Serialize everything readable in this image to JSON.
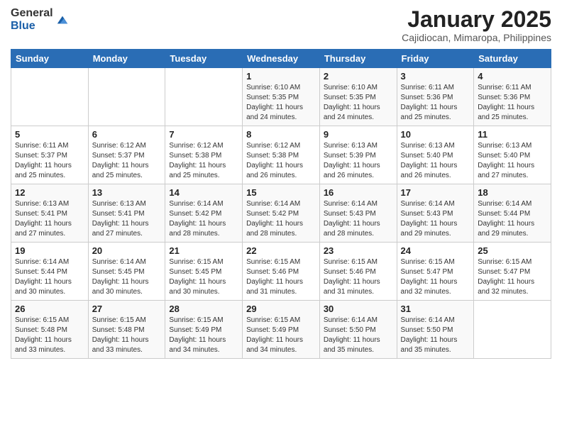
{
  "logo": {
    "general": "General",
    "blue": "Blue"
  },
  "header": {
    "title": "January 2025",
    "location": "Cajidiocan, Mimaropa, Philippines"
  },
  "weekdays": [
    "Sunday",
    "Monday",
    "Tuesday",
    "Wednesday",
    "Thursday",
    "Friday",
    "Saturday"
  ],
  "weeks": [
    [
      {
        "day": "",
        "info": ""
      },
      {
        "day": "",
        "info": ""
      },
      {
        "day": "",
        "info": ""
      },
      {
        "day": "1",
        "info": "Sunrise: 6:10 AM\nSunset: 5:35 PM\nDaylight: 11 hours and 24 minutes."
      },
      {
        "day": "2",
        "info": "Sunrise: 6:10 AM\nSunset: 5:35 PM\nDaylight: 11 hours and 24 minutes."
      },
      {
        "day": "3",
        "info": "Sunrise: 6:11 AM\nSunset: 5:36 PM\nDaylight: 11 hours and 25 minutes."
      },
      {
        "day": "4",
        "info": "Sunrise: 6:11 AM\nSunset: 5:36 PM\nDaylight: 11 hours and 25 minutes."
      }
    ],
    [
      {
        "day": "5",
        "info": "Sunrise: 6:11 AM\nSunset: 5:37 PM\nDaylight: 11 hours and 25 minutes."
      },
      {
        "day": "6",
        "info": "Sunrise: 6:12 AM\nSunset: 5:37 PM\nDaylight: 11 hours and 25 minutes."
      },
      {
        "day": "7",
        "info": "Sunrise: 6:12 AM\nSunset: 5:38 PM\nDaylight: 11 hours and 25 minutes."
      },
      {
        "day": "8",
        "info": "Sunrise: 6:12 AM\nSunset: 5:38 PM\nDaylight: 11 hours and 26 minutes."
      },
      {
        "day": "9",
        "info": "Sunrise: 6:13 AM\nSunset: 5:39 PM\nDaylight: 11 hours and 26 minutes."
      },
      {
        "day": "10",
        "info": "Sunrise: 6:13 AM\nSunset: 5:40 PM\nDaylight: 11 hours and 26 minutes."
      },
      {
        "day": "11",
        "info": "Sunrise: 6:13 AM\nSunset: 5:40 PM\nDaylight: 11 hours and 27 minutes."
      }
    ],
    [
      {
        "day": "12",
        "info": "Sunrise: 6:13 AM\nSunset: 5:41 PM\nDaylight: 11 hours and 27 minutes."
      },
      {
        "day": "13",
        "info": "Sunrise: 6:13 AM\nSunset: 5:41 PM\nDaylight: 11 hours and 27 minutes."
      },
      {
        "day": "14",
        "info": "Sunrise: 6:14 AM\nSunset: 5:42 PM\nDaylight: 11 hours and 28 minutes."
      },
      {
        "day": "15",
        "info": "Sunrise: 6:14 AM\nSunset: 5:42 PM\nDaylight: 11 hours and 28 minutes."
      },
      {
        "day": "16",
        "info": "Sunrise: 6:14 AM\nSunset: 5:43 PM\nDaylight: 11 hours and 28 minutes."
      },
      {
        "day": "17",
        "info": "Sunrise: 6:14 AM\nSunset: 5:43 PM\nDaylight: 11 hours and 29 minutes."
      },
      {
        "day": "18",
        "info": "Sunrise: 6:14 AM\nSunset: 5:44 PM\nDaylight: 11 hours and 29 minutes."
      }
    ],
    [
      {
        "day": "19",
        "info": "Sunrise: 6:14 AM\nSunset: 5:44 PM\nDaylight: 11 hours and 30 minutes."
      },
      {
        "day": "20",
        "info": "Sunrise: 6:14 AM\nSunset: 5:45 PM\nDaylight: 11 hours and 30 minutes."
      },
      {
        "day": "21",
        "info": "Sunrise: 6:15 AM\nSunset: 5:45 PM\nDaylight: 11 hours and 30 minutes."
      },
      {
        "day": "22",
        "info": "Sunrise: 6:15 AM\nSunset: 5:46 PM\nDaylight: 11 hours and 31 minutes."
      },
      {
        "day": "23",
        "info": "Sunrise: 6:15 AM\nSunset: 5:46 PM\nDaylight: 11 hours and 31 minutes."
      },
      {
        "day": "24",
        "info": "Sunrise: 6:15 AM\nSunset: 5:47 PM\nDaylight: 11 hours and 32 minutes."
      },
      {
        "day": "25",
        "info": "Sunrise: 6:15 AM\nSunset: 5:47 PM\nDaylight: 11 hours and 32 minutes."
      }
    ],
    [
      {
        "day": "26",
        "info": "Sunrise: 6:15 AM\nSunset: 5:48 PM\nDaylight: 11 hours and 33 minutes."
      },
      {
        "day": "27",
        "info": "Sunrise: 6:15 AM\nSunset: 5:48 PM\nDaylight: 11 hours and 33 minutes."
      },
      {
        "day": "28",
        "info": "Sunrise: 6:15 AM\nSunset: 5:49 PM\nDaylight: 11 hours and 34 minutes."
      },
      {
        "day": "29",
        "info": "Sunrise: 6:15 AM\nSunset: 5:49 PM\nDaylight: 11 hours and 34 minutes."
      },
      {
        "day": "30",
        "info": "Sunrise: 6:14 AM\nSunset: 5:50 PM\nDaylight: 11 hours and 35 minutes."
      },
      {
        "day": "31",
        "info": "Sunrise: 6:14 AM\nSunset: 5:50 PM\nDaylight: 11 hours and 35 minutes."
      },
      {
        "day": "",
        "info": ""
      }
    ]
  ]
}
